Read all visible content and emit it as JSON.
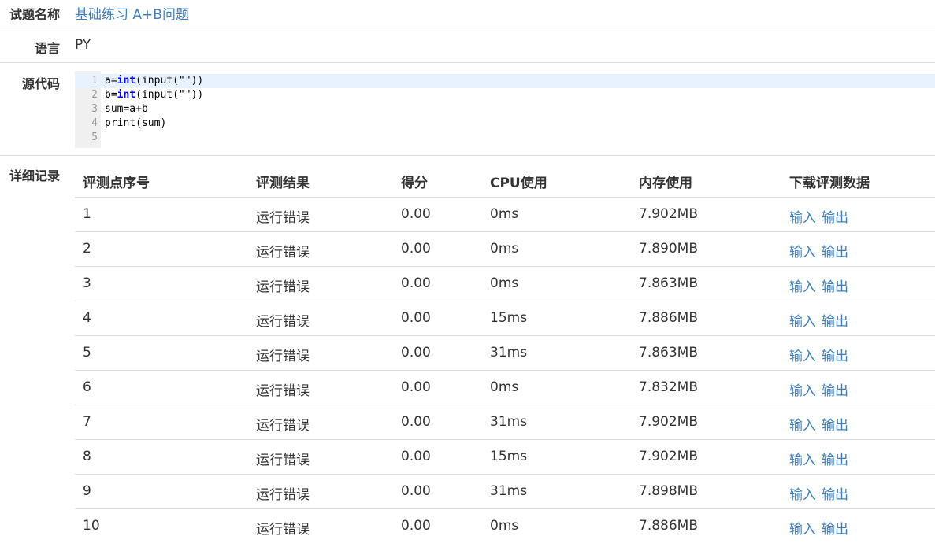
{
  "fields": {
    "problem_label": "试题名称",
    "problem_name": "基础练习 A+B问题",
    "language_label": "语言",
    "language_value": "PY",
    "source_label": "源代码",
    "details_label": "详细记录"
  },
  "code": {
    "lines": [
      {
        "num": "1",
        "pre": "a=",
        "kw": "int",
        "post": "(input(\"\"))"
      },
      {
        "num": "2",
        "pre": "b=",
        "kw": "int",
        "post": "(input(\"\"))"
      },
      {
        "num": "3",
        "pre": "sum=a+b",
        "kw": "",
        "post": ""
      },
      {
        "num": "4",
        "pre": "print(sum)",
        "kw": "",
        "post": ""
      },
      {
        "num": "5",
        "pre": "",
        "kw": "",
        "post": ""
      }
    ]
  },
  "table": {
    "headers": [
      "评测点序号",
      "评测结果",
      "得分",
      "CPU使用",
      "内存使用",
      "下载评测数据"
    ],
    "rows": [
      {
        "id": "1",
        "result": "运行错误",
        "score": "0.00",
        "cpu": "0ms",
        "mem": "7.902MB",
        "input": "输入",
        "output": "输出"
      },
      {
        "id": "2",
        "result": "运行错误",
        "score": "0.00",
        "cpu": "0ms",
        "mem": "7.890MB",
        "input": "输入",
        "output": "输出"
      },
      {
        "id": "3",
        "result": "运行错误",
        "score": "0.00",
        "cpu": "0ms",
        "mem": "7.863MB",
        "input": "输入",
        "output": "输出"
      },
      {
        "id": "4",
        "result": "运行错误",
        "score": "0.00",
        "cpu": "15ms",
        "mem": "7.886MB",
        "input": "输入",
        "output": "输出"
      },
      {
        "id": "5",
        "result": "运行错误",
        "score": "0.00",
        "cpu": "31ms",
        "mem": "7.863MB",
        "input": "输入",
        "output": "输出"
      },
      {
        "id": "6",
        "result": "运行错误",
        "score": "0.00",
        "cpu": "0ms",
        "mem": "7.832MB",
        "input": "输入",
        "output": "输出"
      },
      {
        "id": "7",
        "result": "运行错误",
        "score": "0.00",
        "cpu": "31ms",
        "mem": "7.902MB",
        "input": "输入",
        "output": "输出"
      },
      {
        "id": "8",
        "result": "运行错误",
        "score": "0.00",
        "cpu": "15ms",
        "mem": "7.902MB",
        "input": "输入",
        "output": "输出"
      },
      {
        "id": "9",
        "result": "运行错误",
        "score": "0.00",
        "cpu": "31ms",
        "mem": "7.898MB",
        "input": "输入",
        "output": "输出"
      },
      {
        "id": "10",
        "result": "运行错误",
        "score": "0.00",
        "cpu": "0ms",
        "mem": "7.886MB",
        "input": "输入",
        "output": "输出"
      }
    ]
  },
  "colors": {
    "link": "#3d7fbd",
    "keyword": "#0000ff",
    "active_line": "#e8f2fe"
  }
}
